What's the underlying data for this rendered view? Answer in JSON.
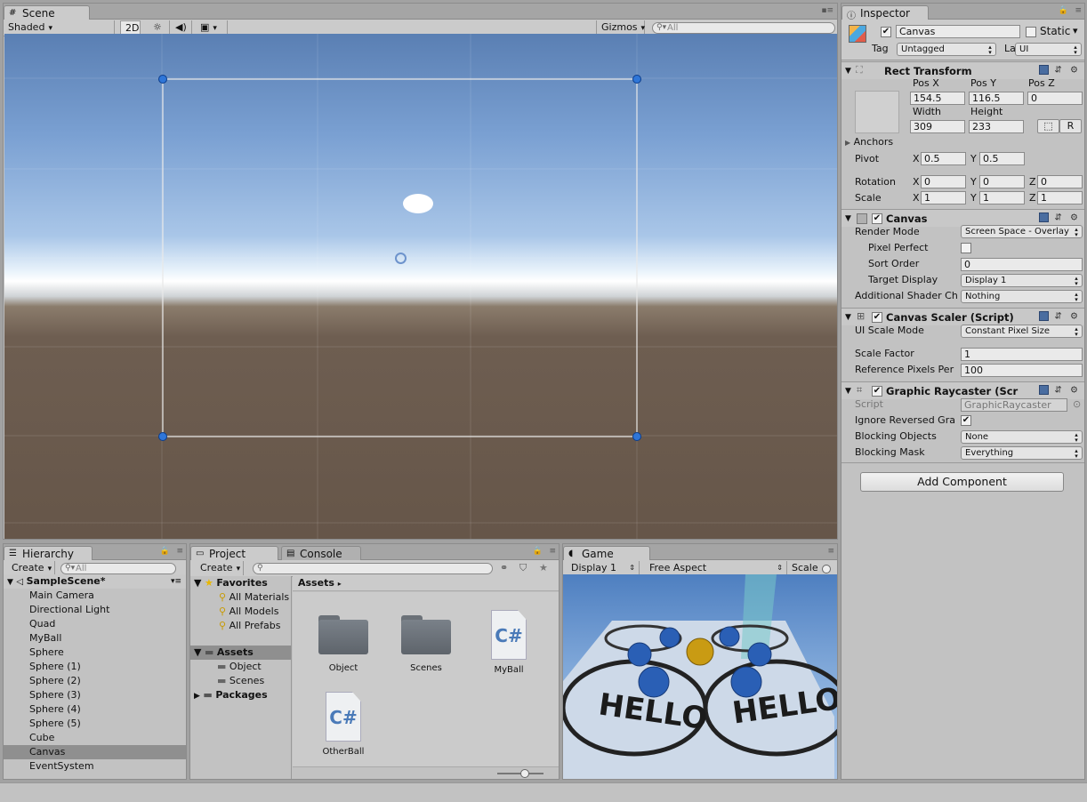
{
  "scene": {
    "tab": "Scene",
    "shading": "Shaded",
    "mode_2d": "2D",
    "gizmos": "Gizmos",
    "search_placeholder": "All"
  },
  "hierarchy": {
    "tab": "Hierarchy",
    "create": "Create",
    "search_placeholder": "All",
    "scene_name": "SampleScene*",
    "items": [
      "Main Camera",
      "Directional Light",
      "Quad",
      "MyBall",
      "Sphere",
      "Sphere (1)",
      "Sphere (2)",
      "Sphere (3)",
      "Sphere (4)",
      "Sphere (5)",
      "Cube",
      "Canvas",
      "EventSystem"
    ],
    "selected": "Canvas"
  },
  "project": {
    "tabs": [
      "Project",
      "Console"
    ],
    "create": "Create",
    "tree": {
      "favorites": "Favorites",
      "fav_items": [
        "All Materials",
        "All Models",
        "All Prefabs"
      ],
      "assets": "Assets",
      "asset_items": [
        "Object",
        "Scenes"
      ],
      "packages": "Packages"
    },
    "breadcrumb": "Assets",
    "files": [
      {
        "name": "Object",
        "icon": "folder-icon"
      },
      {
        "name": "Scenes",
        "icon": "folder-icon"
      },
      {
        "name": "MyBall",
        "icon": "csharp-script-icon"
      },
      {
        "name": "OtherBall",
        "icon": "csharp-script-icon"
      }
    ],
    "csharp_label": "C#"
  },
  "game": {
    "tab": "Game",
    "display": "Display 1",
    "aspect": "Free Aspect",
    "scale": "Scale",
    "hello": "HELLO"
  },
  "inspector": {
    "tab": "Inspector",
    "object_name": "Canvas",
    "static": "Static",
    "tag_label": "Tag",
    "tag": "Untagged",
    "layer_label": "Layer",
    "layer": "UI",
    "rect": {
      "title": "Rect Transform",
      "pos_x_label": "Pos X",
      "pos_y_label": "Pos Y",
      "pos_z_label": "Pos Z",
      "pos_x": "154.5",
      "pos_y": "116.5",
      "pos_z": "0",
      "width_label": "Width",
      "height_label": "Height",
      "width": "309",
      "height": "233",
      "r_btn": "R",
      "anchors": "Anchors",
      "pivot": "Pivot",
      "pivot_x": "0.5",
      "pivot_y": "0.5",
      "rotation": "Rotation",
      "rot_x": "0",
      "rot_y": "0",
      "rot_z": "0",
      "scale": "Scale",
      "scale_x": "1",
      "scale_y": "1",
      "scale_z": "1",
      "x": "X",
      "y": "Y",
      "z": "Z"
    },
    "canvas": {
      "title": "Canvas",
      "render_mode_label": "Render Mode",
      "render_mode": "Screen Space - Overlay",
      "pixel_perfect": "Pixel Perfect",
      "sort_order_label": "Sort Order",
      "sort_order": "0",
      "target_display_label": "Target Display",
      "target_display": "Display 1",
      "shader_label": "Additional Shader Ch",
      "shader": "Nothing"
    },
    "scaler": {
      "title": "Canvas Scaler (Script)",
      "mode_label": "UI Scale Mode",
      "mode": "Constant Pixel Size",
      "factor_label": "Scale Factor",
      "factor": "1",
      "ref_label": "Reference Pixels Per",
      "ref": "100"
    },
    "raycaster": {
      "title": "Graphic Raycaster (Scr",
      "script_label": "Script",
      "script": "GraphicRaycaster",
      "ignore_label": "Ignore Reversed Gra",
      "blocking_label": "Blocking Objects",
      "blocking": "None",
      "mask_label": "Blocking Mask",
      "mask": "Everything"
    },
    "add_component": "Add Component"
  },
  "colors": {
    "accent": "#2f76d8",
    "selection": "#8f8f8f"
  }
}
